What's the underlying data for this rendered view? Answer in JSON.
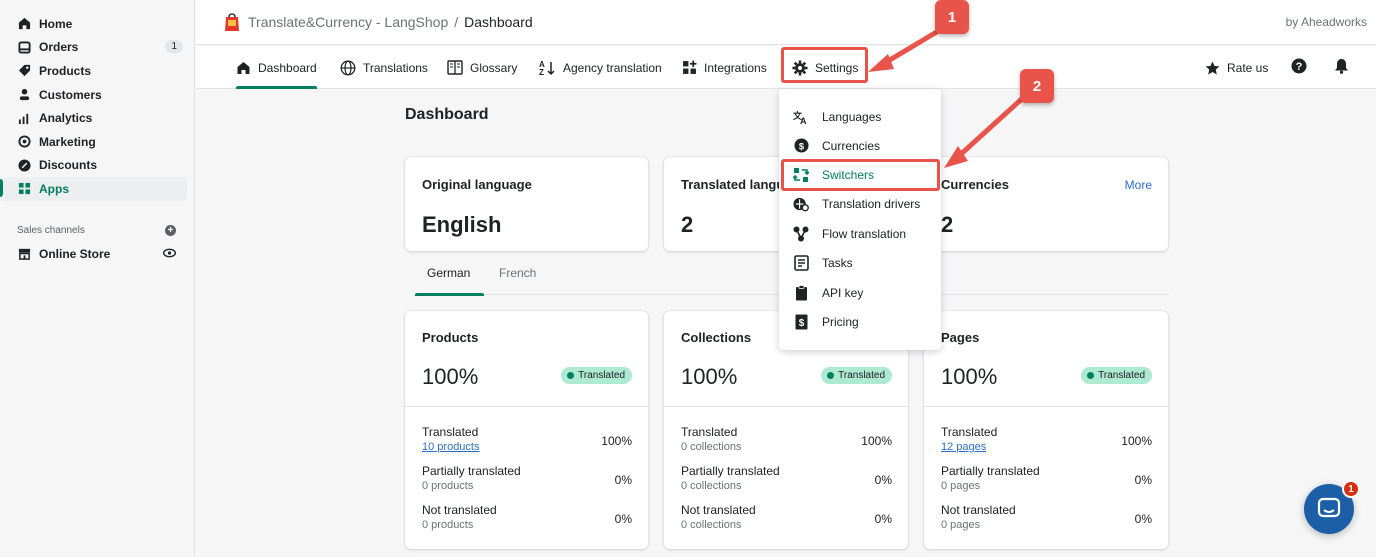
{
  "sidebar": {
    "items": [
      {
        "label": "Home",
        "icon": "home-icon"
      },
      {
        "label": "Orders",
        "icon": "orders-icon",
        "badge": "1"
      },
      {
        "label": "Products",
        "icon": "tag-icon"
      },
      {
        "label": "Customers",
        "icon": "person-icon"
      },
      {
        "label": "Analytics",
        "icon": "bar-chart-icon"
      },
      {
        "label": "Marketing",
        "icon": "target-icon"
      },
      {
        "label": "Discounts",
        "icon": "discount-icon"
      },
      {
        "label": "Apps",
        "icon": "apps-icon",
        "active": true
      }
    ],
    "sales_channels_label": "Sales channels",
    "online_store_label": "Online Store"
  },
  "header": {
    "app_name": "Translate&Currency - LangShop",
    "separator": "/",
    "page": "Dashboard",
    "by": "by Aheadworks"
  },
  "nav": {
    "tabs": [
      "Dashboard",
      "Translations",
      "Glossary",
      "Agency translation",
      "Integrations",
      "Settings"
    ],
    "active_tab": "Dashboard",
    "rate_us": "Rate us"
  },
  "settings_menu": {
    "items": [
      "Languages",
      "Currencies",
      "Switchers",
      "Translation drivers",
      "Flow translation",
      "Tasks",
      "API key",
      "Pricing"
    ],
    "highlighted": "Switchers"
  },
  "annotations": {
    "step1": "1",
    "step2": "2",
    "highlight_color": "#e8534a"
  },
  "main": {
    "title": "Dashboard",
    "summary": [
      {
        "title": "Original language",
        "value": "English"
      },
      {
        "title": "Translated langu",
        "value": "2"
      },
      {
        "title": "Currencies",
        "value": "2",
        "more": "More"
      }
    ],
    "lang_tabs": [
      "German",
      "French"
    ],
    "active_lang": "German",
    "stats": [
      {
        "title": "Products",
        "percent": "100%",
        "status": "Translated",
        "rows": [
          {
            "label": "Translated",
            "sub": "10 products",
            "value": "100%"
          },
          {
            "label": "Partially translated",
            "sub": "0 products",
            "value": "0%"
          },
          {
            "label": "Not translated",
            "sub": "0 products",
            "value": "0%"
          }
        ]
      },
      {
        "title": "Collections",
        "percent": "100%",
        "status": "Translated",
        "rows": [
          {
            "label": "Translated",
            "sub": "0 collections",
            "value": "100%"
          },
          {
            "label": "Partially translated",
            "sub": "0 collections",
            "value": "0%"
          },
          {
            "label": "Not translated",
            "sub": "0 collections",
            "value": "0%"
          }
        ]
      },
      {
        "title": "Pages",
        "percent": "100%",
        "status": "Translated",
        "rows": [
          {
            "label": "Translated",
            "sub": "12 pages",
            "value": "100%"
          },
          {
            "label": "Partially translated",
            "sub": "0 pages",
            "value": "0%"
          },
          {
            "label": "Not translated",
            "sub": "0 pages",
            "value": "0%"
          }
        ]
      }
    ]
  },
  "chat": {
    "count": "1"
  },
  "colors": {
    "accent": "#008060",
    "link": "#2c6ecb",
    "badge_bg": "#aee9d1",
    "annotation": "#e8534a"
  }
}
